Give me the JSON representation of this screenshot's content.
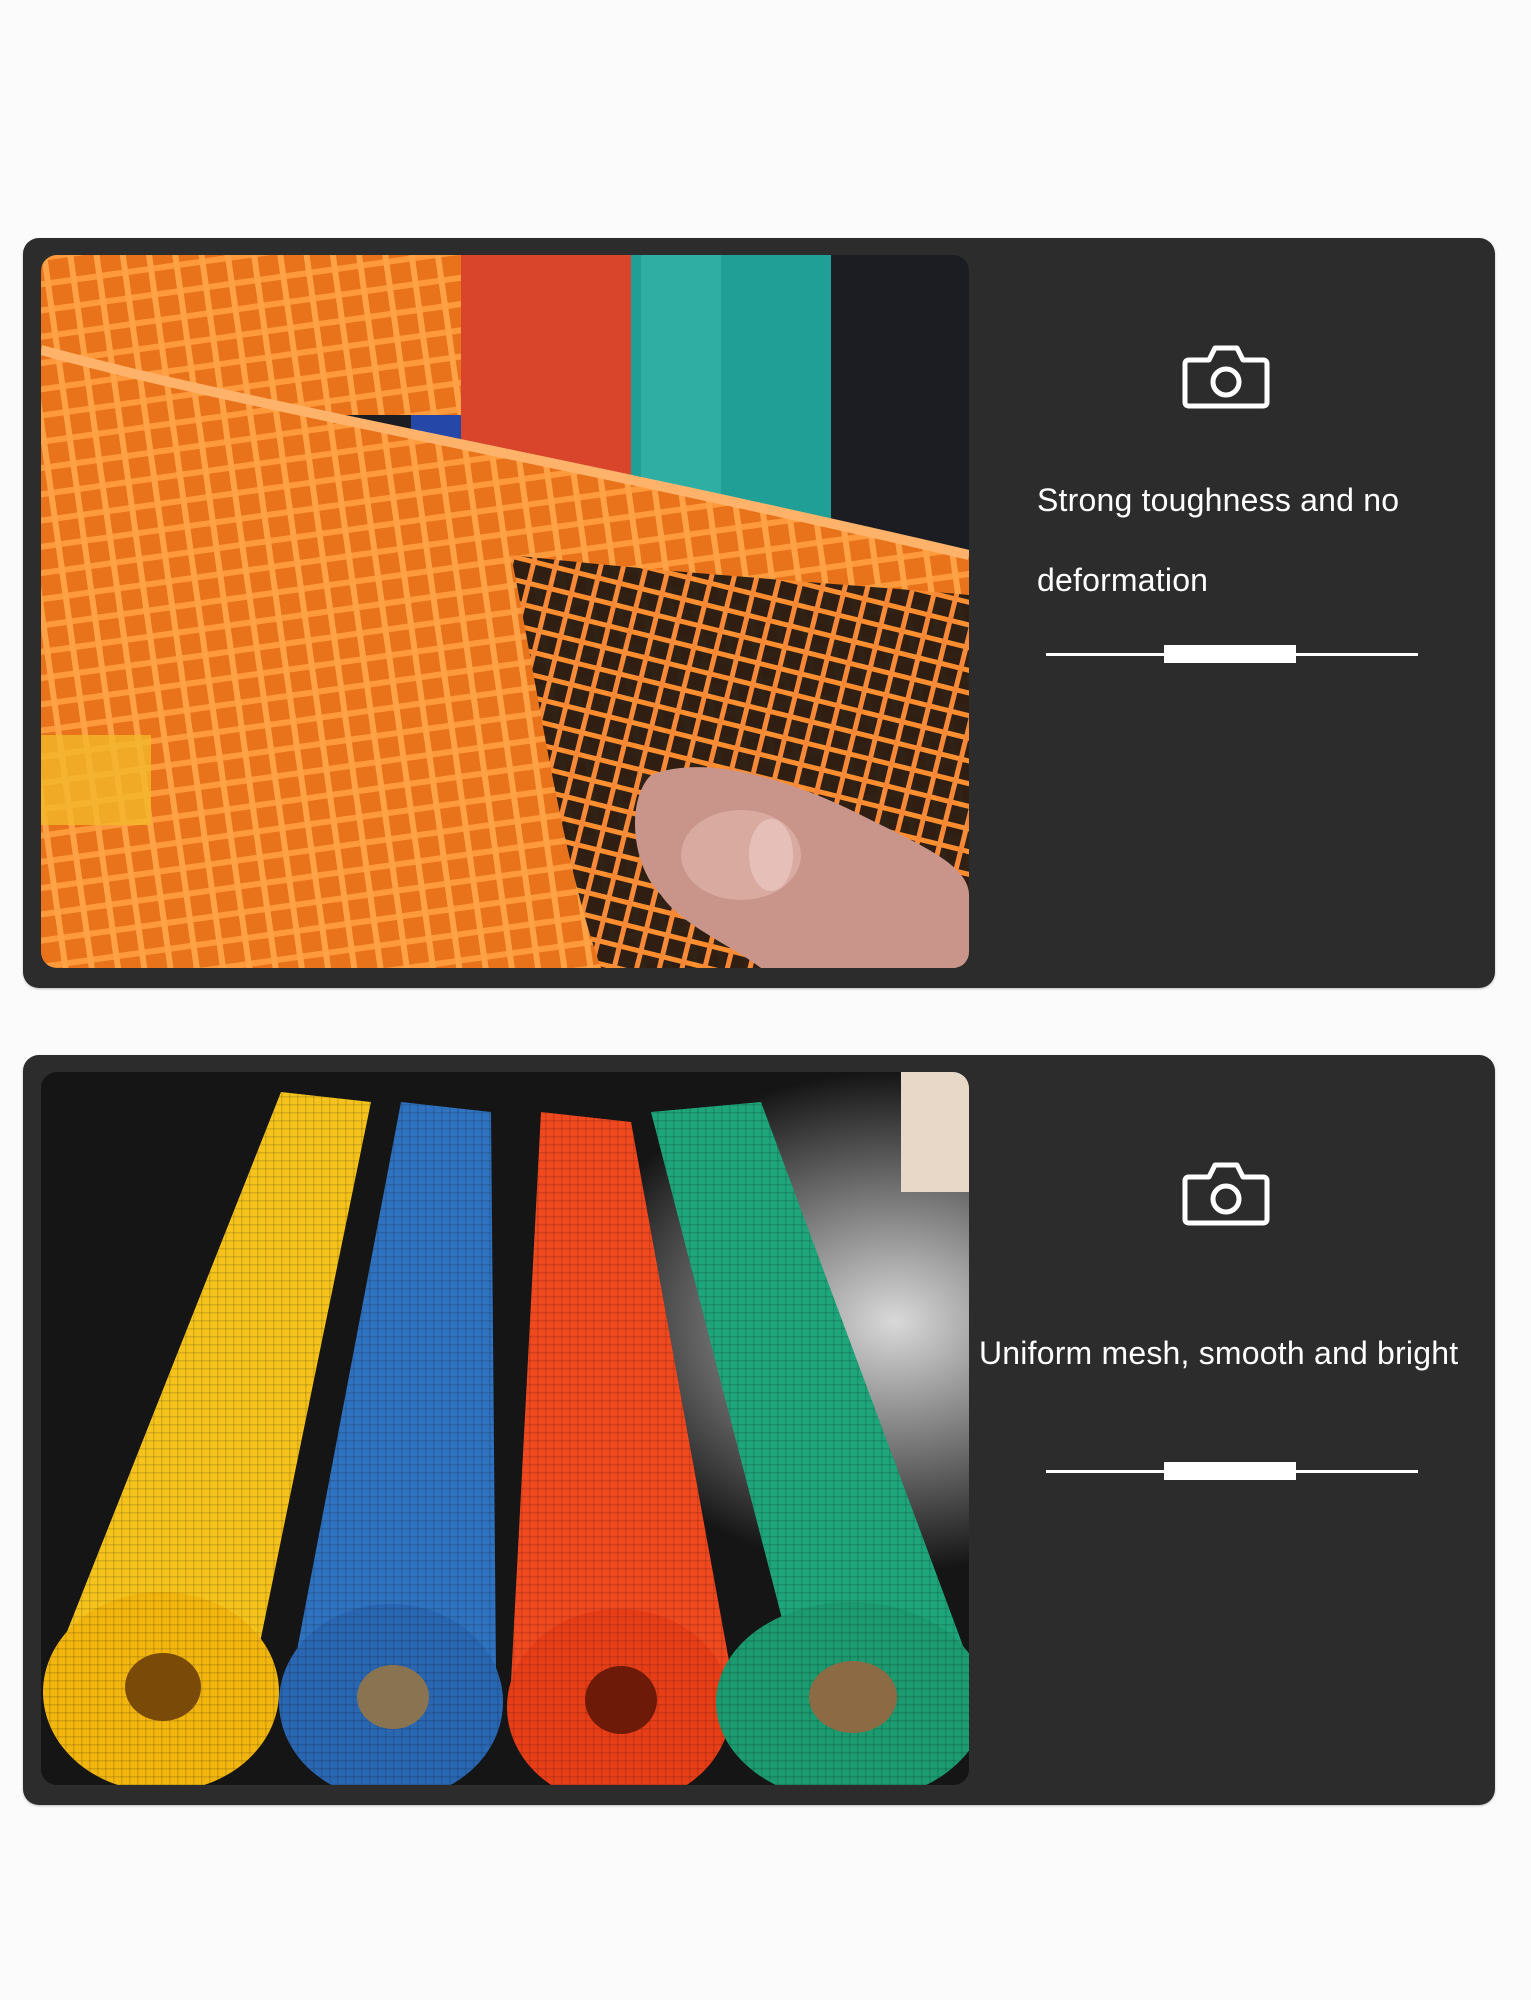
{
  "features": [
    {
      "icon": "camera-icon",
      "caption_line1": "Strong toughness and no",
      "caption_line2": "deformation",
      "photo": "orange-fiberglass-mesh-closeup"
    },
    {
      "icon": "camera-icon",
      "caption": "Uniform mesh, smooth and bright",
      "photo": "colored-mesh-rolls"
    }
  ],
  "colors": {
    "page_background": "#fbfbfb",
    "panel_background": "#2c2c2c",
    "text": "#ffffff",
    "mesh_orange": "#f58a2a",
    "roll_yellow": "#f6c31c",
    "roll_blue": "#2f72c0",
    "roll_red": "#f0491f",
    "roll_green": "#1fa57a"
  }
}
